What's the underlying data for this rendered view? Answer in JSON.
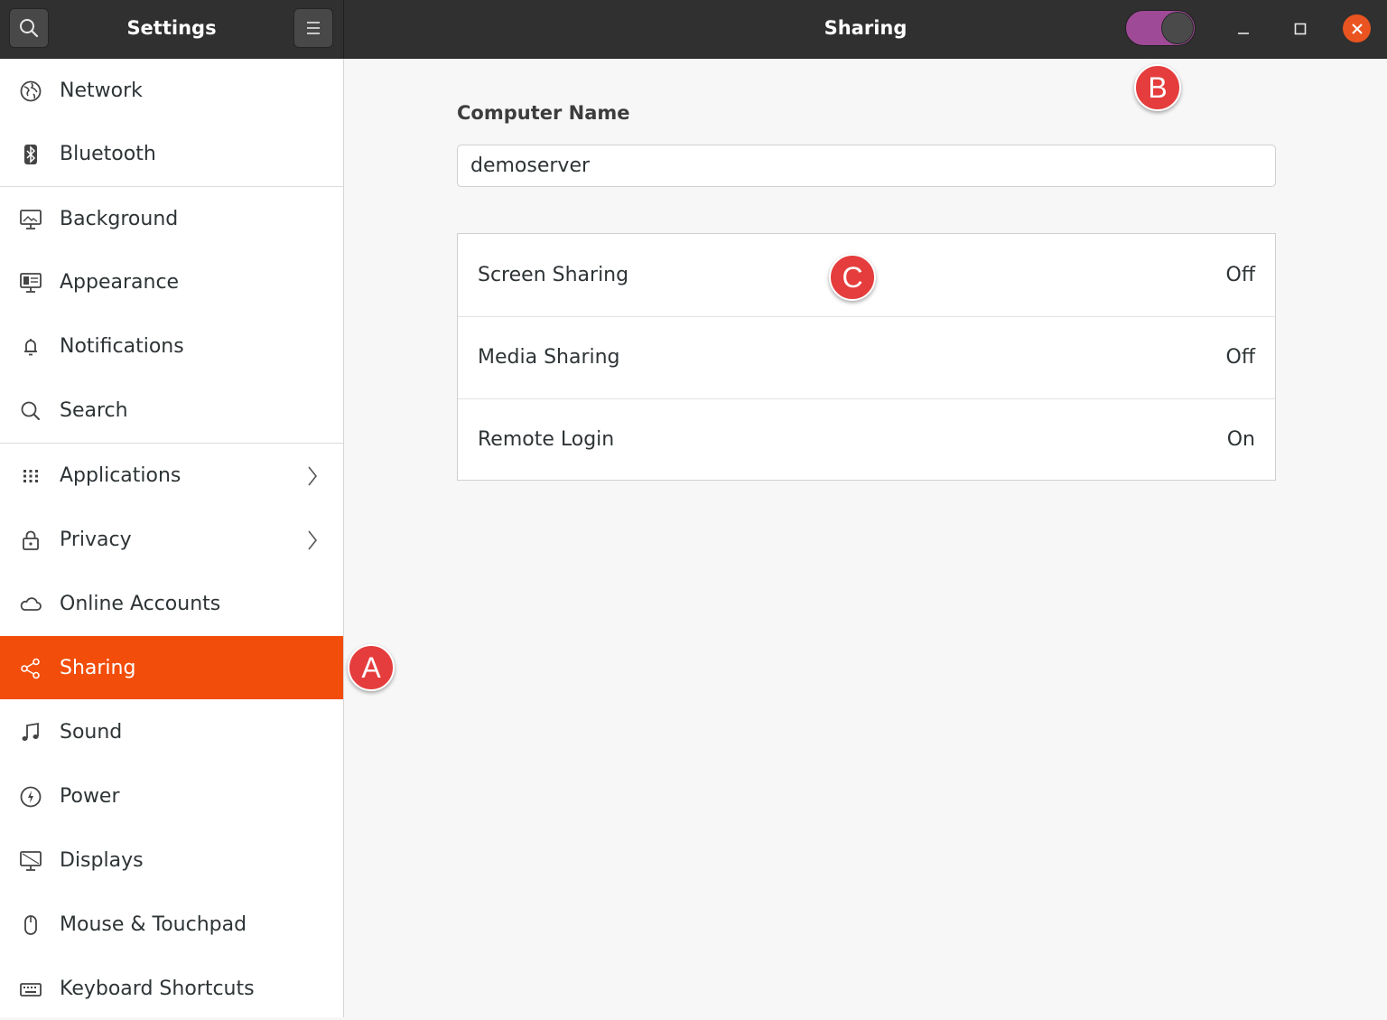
{
  "header": {
    "app_title": "Settings",
    "page_title": "Sharing",
    "sharing_switch_on": true
  },
  "sidebar": {
    "items": [
      {
        "label": "Network",
        "icon": "globe-icon"
      },
      {
        "label": "Bluetooth",
        "icon": "bluetooth-icon"
      },
      {
        "label": "Background",
        "icon": "monitor-icon"
      },
      {
        "label": "Appearance",
        "icon": "appearance-icon"
      },
      {
        "label": "Notifications",
        "icon": "bell-icon"
      },
      {
        "label": "Search",
        "icon": "search-icon"
      },
      {
        "label": "Applications",
        "icon": "grid-icon"
      },
      {
        "label": "Privacy",
        "icon": "lock-icon"
      },
      {
        "label": "Online Accounts",
        "icon": "cloud-icon"
      },
      {
        "label": "Sharing",
        "icon": "share-icon",
        "active": true
      },
      {
        "label": "Sound",
        "icon": "music-note-icon"
      },
      {
        "label": "Power",
        "icon": "power-icon"
      },
      {
        "label": "Displays",
        "icon": "display-icon"
      },
      {
        "label": "Mouse & Touchpad",
        "icon": "mouse-icon"
      },
      {
        "label": "Keyboard Shortcuts",
        "icon": "keyboard-icon"
      }
    ]
  },
  "main": {
    "computer_name_label": "Computer Name",
    "computer_name_value": "demoserver",
    "services": [
      {
        "label": "Screen Sharing",
        "value": "Off"
      },
      {
        "label": "Media Sharing",
        "value": "Off"
      },
      {
        "label": "Remote Login",
        "value": "On"
      }
    ]
  },
  "markers": {
    "a": "A",
    "b": "B",
    "c": "C"
  },
  "colors": {
    "accent": "#f24d0a",
    "switch": "#9e4a96",
    "marker": "#e53d3d"
  }
}
